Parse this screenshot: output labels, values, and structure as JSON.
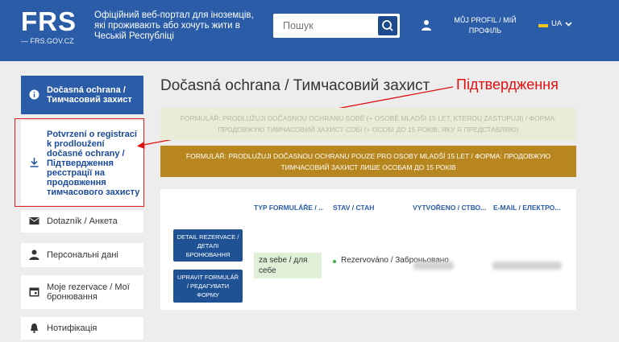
{
  "header": {
    "logo": "FRS",
    "logo_sub": "— FRS.GOV.CZ",
    "tagline": "Офіційний веб-портал для іноземців, які проживають або хочуть жити в Чеській Республіці",
    "search_placeholder": "Пошук",
    "profile_label": "MŮJ PROFIL / МІЙ ПРОФІЛЬ",
    "language": "UA"
  },
  "sidebar": {
    "items": [
      {
        "label": "Dočasná ochrana / Тимчасовий захист",
        "icon": "info-icon"
      },
      {
        "label": "Potvrzení o registraci k prodloužení dočasné ochrany / Підтвердження реєстрації на продовження тимчасового захисту",
        "icon": "download-icon"
      },
      {
        "label": "Dotazník / Анкета",
        "icon": "mail-icon"
      },
      {
        "label": "Персональні дані",
        "icon": "person-icon"
      },
      {
        "label": "Moje rezervace / Мої бронювання",
        "icon": "calendar-icon"
      },
      {
        "label": "Нотифікація",
        "icon": "bell-icon"
      }
    ]
  },
  "main": {
    "title": "Dočasná ochrana / Тимчасовий захист",
    "annotation": "Підтвердження",
    "banners": [
      {
        "text": "FORMULÁŘ: PRODLUŽUJI DOČASNOU OCHRANU SOBĚ (+ OSOBĚ MLADŠÍ 15 LET, KTEROU ZASTUPUJI) / ФОРМА: ПРОДОВЖУЮ ТИМЧАСОВИЙ ЗАХИСТ СОБІ (+ ОСОБІ ДО 15 РОКІВ, ЯКУ Я ПРЕДСТАВЛЯЮ)"
      },
      {
        "text": "FORMULÁŘ: PRODLUŽUJI DOČASNOU OCHRANU POUZE PRO OSOBY MLADŠÍ 15 LET / ФОРМА: ПРОДОВЖУЮ ТИМЧАСОВИЙ ЗАХИСТ ЛИШЕ ОСОБАМ ДО 15 РОКІВ"
      }
    ],
    "table": {
      "headers": [
        "TYP FORMULÁŘE / ...",
        "STAV / СТАН",
        "VYTVOŘENO / СТВО...",
        "E-MAIL / ЕЛЕКТРО..."
      ],
      "detail_button": "DETAIL REZERVACE / ДЕТАЛІ БРОНЮВАННЯ",
      "edit_button": "UPRAVIT FORMULÁŘ / РЕДАГУВАТИ ФОРМУ",
      "type_value": "za sebe / для себе",
      "status_value": "Rezervováno / Заброньовано"
    }
  },
  "colors": {
    "brand": "#2a5ca8",
    "banner_light": "#e8edd8",
    "banner_gold": "#b8861e",
    "annotation": "#e01010"
  }
}
